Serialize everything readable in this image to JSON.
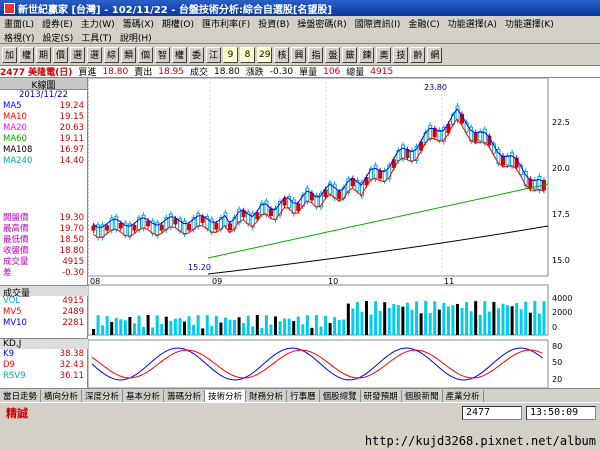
{
  "window": {
    "title": "新世紀贏家 [台灣] - 102/11/22 - 台盤技術分析:綜合自選股[名望股]"
  },
  "menu": {
    "row1": [
      "畫面(L)",
      "證券(E)",
      "主力(W)",
      "籌碼(X)",
      "期權(O)",
      "匯市利率(F)",
      "投資(B)",
      "操盤密碼(R)",
      "國際資訊(I)",
      "金融(C)",
      "功能選擇(A)",
      "功能選擇(K)"
    ],
    "row2": [
      "格視(Y)",
      "設定(S)",
      "工具(T)",
      "說明(H)"
    ]
  },
  "toolbar": [
    "加",
    "權",
    "期",
    "價",
    "選",
    "選",
    "綜",
    "類",
    "個",
    "智",
    "權",
    "委",
    "江",
    "9",
    "8",
    "29",
    "核",
    "興",
    "指",
    "盤",
    "籤",
    "鍊",
    "奧",
    "技",
    "齡",
    "網"
  ],
  "infobar": {
    "code": "2477 美隆電(日)",
    "buy_label": "買進",
    "buy_value": "18.80",
    "sell_label": "賣出",
    "sell_value": "18.95",
    "deal_label": "成交",
    "deal_value": "18.80",
    "change_label": "漲跌",
    "change_value": "-0.30",
    "volume_label": "單量",
    "volume_value": "106",
    "total_label": "總量",
    "total_value": "4915"
  },
  "left_panel": {
    "title": "K線圖",
    "date": "2013/11/22",
    "ma": [
      {
        "label": "MA5",
        "value": "19.24",
        "color": "#0000ff"
      },
      {
        "label": "MA10",
        "value": "19.15",
        "color": "#ff0000"
      },
      {
        "label": "MA20",
        "value": "20.63",
        "color": "#ff00ff"
      },
      {
        "label": "MA60",
        "value": "19.11",
        "color": "#00aa00"
      },
      {
        "label": "MA108",
        "value": "16.97",
        "color": "#000000"
      },
      {
        "label": "MA240",
        "value": "14.40",
        "color": "#00aaaa"
      }
    ],
    "quote": [
      {
        "label": "開盤價",
        "value": "19.30"
      },
      {
        "label": "最高價",
        "value": "19.70"
      },
      {
        "label": "最低價",
        "value": "18.50"
      },
      {
        "label": "收盤價",
        "value": "18.80"
      },
      {
        "label": "成交量",
        "value": "4915"
      },
      {
        "label": "差",
        "value": "-0.30"
      }
    ],
    "vol_title": "成交量",
    "vol": [
      {
        "label": "VOL",
        "value": "4915",
        "color": "#00aaff"
      },
      {
        "label": "MV5",
        "value": "2489",
        "color": "#ff0000"
      },
      {
        "label": "MV10",
        "value": "2281",
        "color": "#0000ff"
      }
    ],
    "kd_title": "KD,J",
    "kd": [
      {
        "label": "K9",
        "value": "38.38",
        "color": "#0000ff"
      },
      {
        "label": "D9",
        "value": "32.43",
        "color": "#ff0000"
      },
      {
        "label": "RSV9",
        "value": "36.11",
        "color": "#00aaaa"
      }
    ]
  },
  "chart": {
    "price_axis": [
      "22.5",
      "20.0",
      "17.5",
      "15.0"
    ],
    "months": [
      "08",
      "09",
      "10",
      "11"
    ],
    "high_mark": "23.80",
    "low_mark": "15.20",
    "vol_axis": [
      "4000",
      "2000",
      "0"
    ],
    "kd_axis": [
      "80",
      "50",
      "20"
    ]
  },
  "bottom_tabs": [
    "當日走勢",
    "橫向分析",
    "深度分析",
    "基本分析",
    "籌碼分析",
    "技術分析",
    "財務分析",
    "行事曆",
    "個股總覽",
    "研發預期",
    "個股新聞",
    "產業分析"
  ],
  "status": {
    "mode": "精誠",
    "code": "2477",
    "time": "13:50:09"
  },
  "watermark": "http://kujd3268.pixnet.net/album"
}
